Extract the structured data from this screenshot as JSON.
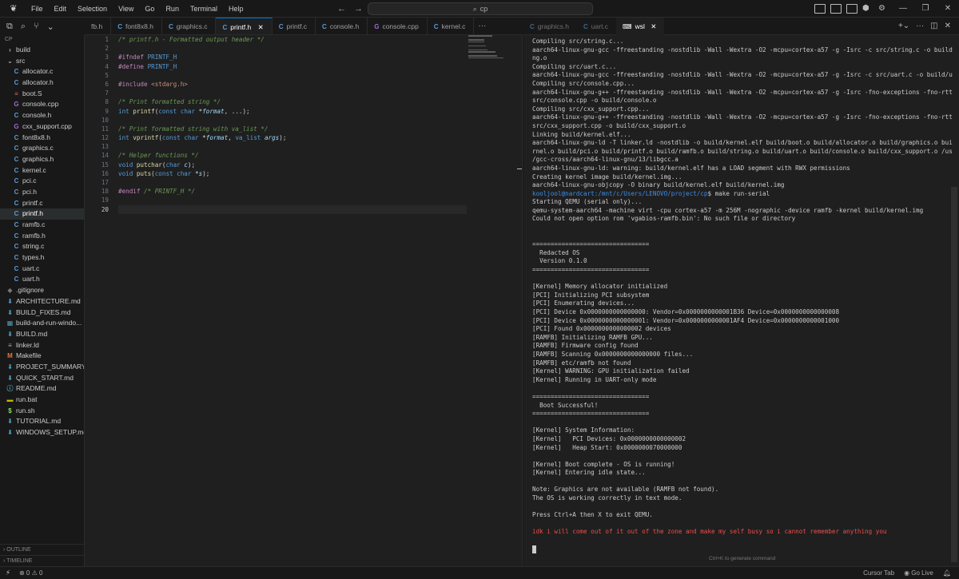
{
  "menu": [
    "File",
    "Edit",
    "Selection",
    "View",
    "Go",
    "Run",
    "Terminal",
    "Help"
  ],
  "command_center": {
    "text": "cp"
  },
  "explorer": {
    "root": "CP",
    "items": [
      {
        "label": "build",
        "type": "folder",
        "icon": "chevron-right-icon",
        "indent": 0
      },
      {
        "label": "src",
        "type": "folder-open",
        "icon": "chevron-down-icon",
        "indent": 0
      },
      {
        "label": "allocator.c",
        "type": "c",
        "indent": 1
      },
      {
        "label": "allocator.h",
        "type": "c",
        "indent": 1
      },
      {
        "label": "boot.S",
        "type": "s",
        "indent": 1
      },
      {
        "label": "console.cpp",
        "type": "cpp",
        "indent": 1
      },
      {
        "label": "console.h",
        "type": "c",
        "indent": 1
      },
      {
        "label": "cxx_support.cpp",
        "type": "cpp",
        "indent": 1
      },
      {
        "label": "font8x8.h",
        "type": "c",
        "indent": 1
      },
      {
        "label": "graphics.c",
        "type": "c",
        "indent": 1
      },
      {
        "label": "graphics.h",
        "type": "c",
        "indent": 1
      },
      {
        "label": "kernel.c",
        "type": "c",
        "indent": 1
      },
      {
        "label": "pci.c",
        "type": "c",
        "indent": 1
      },
      {
        "label": "pci.h",
        "type": "c",
        "indent": 1
      },
      {
        "label": "printf.c",
        "type": "c",
        "indent": 1
      },
      {
        "label": "printf.h",
        "type": "c",
        "indent": 1,
        "selected": true
      },
      {
        "label": "ramfb.c",
        "type": "c",
        "indent": 1
      },
      {
        "label": "ramfb.h",
        "type": "c",
        "indent": 1
      },
      {
        "label": "string.c",
        "type": "c",
        "indent": 1
      },
      {
        "label": "types.h",
        "type": "c",
        "indent": 1
      },
      {
        "label": "uart.c",
        "type": "c",
        "indent": 1
      },
      {
        "label": "uart.h",
        "type": "c",
        "indent": 1
      },
      {
        "label": ".gitignore",
        "type": "git",
        "indent": 0
      },
      {
        "label": "ARCHITECTURE.md",
        "type": "md",
        "indent": 0
      },
      {
        "label": "BUILD_FIXES.md",
        "type": "md",
        "indent": 0
      },
      {
        "label": "build-and-run-windo...",
        "type": "win",
        "indent": 0
      },
      {
        "label": "BUILD.md",
        "type": "md",
        "indent": 0
      },
      {
        "label": "linker.ld",
        "type": "ld",
        "indent": 0
      },
      {
        "label": "Makefile",
        "type": "mk",
        "indent": 0
      },
      {
        "label": "PROJECT_SUMMARY....",
        "type": "md",
        "indent": 0
      },
      {
        "label": "QUICK_START.md",
        "type": "md",
        "indent": 0
      },
      {
        "label": "README.md",
        "type": "info",
        "indent": 0
      },
      {
        "label": "run.bat",
        "type": "bat",
        "indent": 0
      },
      {
        "label": "run.sh",
        "type": "sh",
        "indent": 0
      },
      {
        "label": "TUTORIAL.md",
        "type": "md",
        "indent": 0
      },
      {
        "label": "WINDOWS_SETUP.md",
        "type": "md",
        "indent": 0
      }
    ],
    "outline_label": "OUTLINE",
    "timeline_label": "TIMELINE"
  },
  "editor_tabs": [
    {
      "label": "fb.h",
      "type": "none"
    },
    {
      "label": "font8x8.h",
      "type": "c"
    },
    {
      "label": "graphics.c",
      "type": "c"
    },
    {
      "label": "printf.h",
      "type": "c",
      "active": true,
      "closable": true
    },
    {
      "label": "printf.c",
      "type": "c"
    },
    {
      "label": "console.h",
      "type": "c"
    },
    {
      "label": "console.cpp",
      "type": "cpp"
    },
    {
      "label": "kernel.c",
      "type": "c"
    }
  ],
  "terminal_tabs": [
    {
      "label": "graphics.h",
      "type": "c"
    },
    {
      "label": "uart.c",
      "type": "c"
    },
    {
      "label": "wsl",
      "type": "terminal",
      "active": true
    }
  ],
  "code": {
    "current_line": 20,
    "lines": [
      [
        {
          "t": "/* printf.h - Formatted output header */",
          "c": "comment"
        }
      ],
      [],
      [
        {
          "t": "#ifndef ",
          "c": "pp"
        },
        {
          "t": "PRINTF_H",
          "c": "macro"
        }
      ],
      [
        {
          "t": "#define ",
          "c": "pp"
        },
        {
          "t": "PRINTF_H",
          "c": "macro"
        }
      ],
      [],
      [
        {
          "t": "#include ",
          "c": "pp"
        },
        {
          "t": "<stdarg.h>",
          "c": "str"
        }
      ],
      [],
      [
        {
          "t": "/* Print formatted string */",
          "c": "comment"
        }
      ],
      [
        {
          "t": "int ",
          "c": "kw"
        },
        {
          "t": "printf",
          "c": "fn"
        },
        {
          "t": "(",
          "c": ""
        },
        {
          "t": "const char",
          "c": "kw"
        },
        {
          "t": " *",
          "c": ""
        },
        {
          "t": "format",
          "c": "param"
        },
        {
          "t": ", ...);",
          "c": ""
        }
      ],
      [],
      [
        {
          "t": "/* Print formatted string with va_list */",
          "c": "comment"
        }
      ],
      [
        {
          "t": "int ",
          "c": "kw"
        },
        {
          "t": "vprintf",
          "c": "fn"
        },
        {
          "t": "(",
          "c": ""
        },
        {
          "t": "const char",
          "c": "kw"
        },
        {
          "t": " *",
          "c": ""
        },
        {
          "t": "format",
          "c": "param"
        },
        {
          "t": ", ",
          "c": ""
        },
        {
          "t": "va_list",
          "c": "kw"
        },
        {
          "t": " ",
          "c": ""
        },
        {
          "t": "args",
          "c": "param"
        },
        {
          "t": ");",
          "c": ""
        }
      ],
      [],
      [
        {
          "t": "/* Helper functions */",
          "c": "comment"
        }
      ],
      [
        {
          "t": "void ",
          "c": "kw"
        },
        {
          "t": "putchar",
          "c": "fn"
        },
        {
          "t": "(",
          "c": ""
        },
        {
          "t": "char",
          "c": "kw"
        },
        {
          "t": " ",
          "c": ""
        },
        {
          "t": "c",
          "c": "param"
        },
        {
          "t": ");",
          "c": ""
        }
      ],
      [
        {
          "t": "void ",
          "c": "kw"
        },
        {
          "t": "puts",
          "c": "fn"
        },
        {
          "t": "(",
          "c": ""
        },
        {
          "t": "const char",
          "c": "kw"
        },
        {
          "t": " *",
          "c": ""
        },
        {
          "t": "s",
          "c": "param"
        },
        {
          "t": ");",
          "c": ""
        }
      ],
      [],
      [
        {
          "t": "#endif ",
          "c": "pp"
        },
        {
          "t": "/* PRINTF_H */",
          "c": "comment"
        }
      ],
      [],
      []
    ]
  },
  "terminal": {
    "lines": [
      {
        "text": "Compiling src/string.c..."
      },
      {
        "text": "aarch64-linux-gnu-gcc -ffreestanding -nostdlib -Wall -Wextra -O2 -mcpu=cortex-a57 -g -Isrc -c src/string.c -o build/stri"
      },
      {
        "text": "ng.o"
      },
      {
        "text": "Compiling src/uart.c..."
      },
      {
        "text": "aarch64-linux-gnu-gcc -ffreestanding -nostdlib -Wall -Wextra -O2 -mcpu=cortex-a57 -g -Isrc -c src/uart.c -o build/uart.o"
      },
      {
        "text": "Compiling src/console.cpp..."
      },
      {
        "text": "aarch64-linux-gnu-g++ -ffreestanding -nostdlib -Wall -Wextra -O2 -mcpu=cortex-a57 -g -Isrc -fno-exceptions -fno-rtti -c"
      },
      {
        "text": "src/console.cpp -o build/console.o"
      },
      {
        "text": "Compiling src/cxx_support.cpp..."
      },
      {
        "text": "aarch64-linux-gnu-g++ -ffreestanding -nostdlib -Wall -Wextra -O2 -mcpu=cortex-a57 -g -Isrc -fno-exceptions -fno-rtti -c"
      },
      {
        "text": "src/cxx_support.cpp -o build/cxx_support.o"
      },
      {
        "text": "Linking build/kernel.elf..."
      },
      {
        "text": "aarch64-linux-gnu-ld -T linker.ld -nostdlib -o build/kernel.elf build/boot.o build/allocator.o build/graphics.o build/ke"
      },
      {
        "text": "rnel.o build/pci.o build/printf.o build/ramfb.o build/string.o build/uart.o build/console.o build/cxx_support.o /usr/lib"
      },
      {
        "text": "/gcc-cross/aarch64-linux-gnu/13/libgcc.a"
      },
      {
        "text": "aarch64-linux-gnu-ld: warning: build/kernel.elf has a LOAD segment with RWX permissions"
      },
      {
        "text": "Creating kernel image build/kernel.img..."
      },
      {
        "text": "aarch64-linux-gnu-objcopy -O binary build/kernel.elf build/kernel.img"
      },
      {
        "kind": "prompt",
        "user": "kooljool@nardcart",
        "path": ":/mnt/c/Users/LENOVO/project/cp",
        "cmd": "$ make run-serial"
      },
      {
        "text": "Starting QEMU (serial only)..."
      },
      {
        "text": "qemu-system-aarch64 -machine virt -cpu cortex-a57 -m 256M -nographic -device ramfb -kernel build/kernel.img"
      },
      {
        "text": "Could not open option rom 'vgabios-ramfb.bin': No such file or directory"
      },
      {
        "text": ""
      },
      {
        "text": ""
      },
      {
        "text": "================================"
      },
      {
        "text": "  Redacted OS"
      },
      {
        "text": "  Version 0.1.0"
      },
      {
        "text": "================================"
      },
      {
        "text": ""
      },
      {
        "text": "[Kernel] Memory allocator initialized"
      },
      {
        "text": "[PCI] Initializing PCI subsystem"
      },
      {
        "text": "[PCI] Enumerating devices..."
      },
      {
        "text": "[PCI] Device 0x0000000000000000: Vendor=0x0000000000001B36 Device=0x0000000000000008"
      },
      {
        "text": "[PCI] Device 0x0000000000000001: Vendor=0x0000000000001AF4 Device=0x0000000000001000"
      },
      {
        "text": "[PCI] Found 0x0000000000000002 devices"
      },
      {
        "text": "[RAMFB] Initializing RAMFB GPU..."
      },
      {
        "text": "[RAMFB] Firmware config found"
      },
      {
        "text": "[RAMFB] Scanning 0x0000000000000000 files..."
      },
      {
        "text": "[RAMFB] etc/ramfb not found"
      },
      {
        "text": "[Kernel] WARNING: GPU initialization failed"
      },
      {
        "text": "[Kernel] Running in UART-only mode"
      },
      {
        "text": ""
      },
      {
        "text": "================================"
      },
      {
        "text": "  Boot Successful!"
      },
      {
        "text": "================================"
      },
      {
        "text": ""
      },
      {
        "text": "[Kernel] System Information:"
      },
      {
        "text": "[Kernel]   PCI Devices: 0x0000000000000002"
      },
      {
        "text": "[Kernel]   Heap Start: 0x0000000070000000"
      },
      {
        "text": ""
      },
      {
        "text": "[Kernel] Boot complete - OS is running!"
      },
      {
        "text": "[Kernel] Entering idle state..."
      },
      {
        "text": ""
      },
      {
        "text": "Note: Graphics are not available (RAMFB not found)."
      },
      {
        "text": "The OS is working correctly in text mode."
      },
      {
        "text": ""
      },
      {
        "text": "Press Ctrl+A then X to exit QEMU."
      },
      {
        "text": ""
      },
      {
        "kind": "red",
        "text": "idk i will come out of it out of the zone and make my self busy so i cannot remember anything you"
      },
      {
        "text": ""
      },
      {
        "kind": "cursor",
        "text": ""
      }
    ],
    "hint": "Ctrl+K to generate command"
  },
  "status": {
    "problems": "⊗ 0 ⚠ 0",
    "cursor_tab": "Cursor Tab",
    "go_live": "Go Live"
  },
  "colors": {
    "accent": "#0078d4",
    "background": "#181818",
    "editor_bg": "#1f1f1f"
  }
}
